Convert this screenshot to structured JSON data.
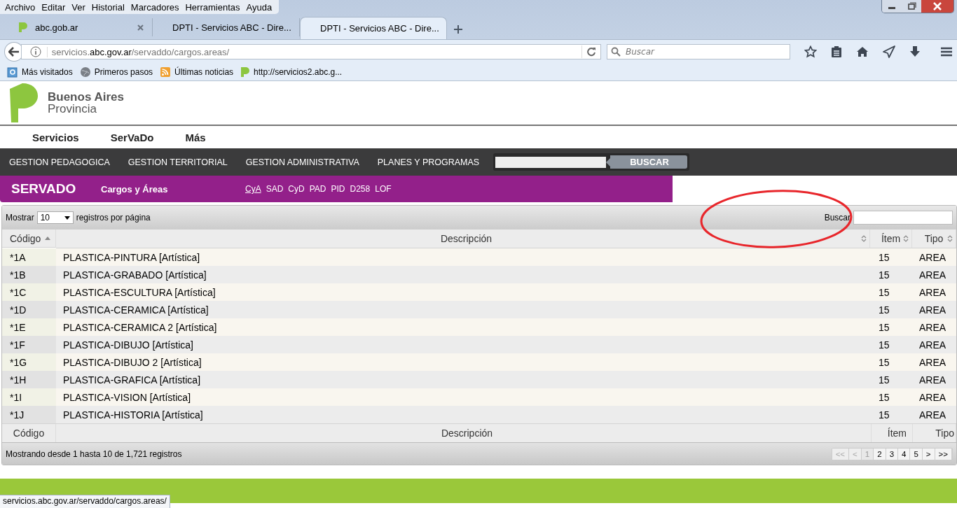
{
  "menu_bar": [
    "Archivo",
    "Editar",
    "Ver",
    "Historial",
    "Marcadores",
    "Herramientas",
    "Ayuda"
  ],
  "tabs": [
    {
      "label": "abc.gob.ar",
      "selected": false
    },
    {
      "label": "DPTI - Servicios ABC - Dire...",
      "selected": false
    },
    {
      "label": "DPTI - Servicios ABC - Dire...",
      "selected": true
    }
  ],
  "address_bar": {
    "url": "servicios.**abc.gov.ar**/servaddo/cargos.areas/"
  },
  "search_bar": {
    "placeholder": "Buscar"
  },
  "bookmarks": [
    {
      "label": "Más visitados",
      "kind": "folder"
    },
    {
      "label": "Primeros pasos",
      "kind": "globe"
    },
    {
      "label": "Últimas noticias",
      "kind": "feed"
    },
    {
      "label": "http://servicios2.abc.g...",
      "kind": "site"
    }
  ],
  "site": {
    "logo": {
      "line1": "Buenos Aires",
      "line2": "Provincia"
    },
    "main_nav": [
      "Servicios",
      "SerVaDo",
      "Más"
    ],
    "sections": [
      "GESTION PEDAGOGICA",
      "GESTION TERRITORIAL",
      "GESTION ADMINISTRATIVA",
      "PLANES Y PROGRAMAS"
    ],
    "search_button": "BUSCAR",
    "banner": {
      "title": "SERVADO",
      "subtitle": "Cargos y Áreas",
      "links": [
        {
          "label": "CyA",
          "selected": true
        },
        {
          "label": "SAD",
          "selected": false
        },
        {
          "label": "CyD",
          "selected": false
        },
        {
          "label": "PAD",
          "selected": false
        },
        {
          "label": "PID",
          "selected": false
        },
        {
          "label": "D258",
          "selected": false
        },
        {
          "label": "LOF",
          "selected": false
        }
      ]
    }
  },
  "table": {
    "length_before": "Mostrar",
    "length_value": "10",
    "length_after": "registros por página",
    "filter_label": "Buscar",
    "columns": [
      {
        "label": "Código",
        "sorted_ascending": true
      },
      {
        "label": "Descripción",
        "sorted_ascending": false
      },
      {
        "label": "Ítem",
        "sorted_ascending": false
      },
      {
        "label": "Tipo",
        "sorted_ascending": false
      }
    ],
    "rows": [
      {
        "code": "*1A",
        "description": "PLASTICA-PINTURA [Artística]",
        "item": "15",
        "type": "AREA"
      },
      {
        "code": "*1B",
        "description": "PLASTICA-GRABADO [Artística]",
        "item": "15",
        "type": "AREA"
      },
      {
        "code": "*1C",
        "description": "PLASTICA-ESCULTURA [Artística]",
        "item": "15",
        "type": "AREA"
      },
      {
        "code": "*1D",
        "description": "PLASTICA-CERAMICA [Artística]",
        "item": "15",
        "type": "AREA"
      },
      {
        "code": "*1E",
        "description": "PLASTICA-CERAMICA 2 [Artística]",
        "item": "15",
        "type": "AREA"
      },
      {
        "code": "*1F",
        "description": "PLASTICA-DIBUJO [Artística]",
        "item": "15",
        "type": "AREA"
      },
      {
        "code": "*1G",
        "description": "PLASTICA-DIBUJO 2 [Artística]",
        "item": "15",
        "type": "AREA"
      },
      {
        "code": "*1H",
        "description": "PLASTICA-GRAFICA [Artística]",
        "item": "15",
        "type": "AREA"
      },
      {
        "code": "*1I",
        "description": "PLASTICA-VISION [Artística]",
        "item": "15",
        "type": "AREA"
      },
      {
        "code": "*1J",
        "description": "PLASTICA-HISTORIA [Artística]",
        "item": "15",
        "type": "AREA"
      }
    ],
    "footer_columns": [
      "Código",
      "Descripción",
      "Ítem",
      "Tipo"
    ],
    "info": "Mostrando desde 1 hasta 10 de 1,721 registros",
    "pagination": [
      {
        "label": "<<",
        "kind": "disabled"
      },
      {
        "label": "<",
        "kind": "disabled"
      },
      {
        "label": "1",
        "kind": "current"
      },
      {
        "label": "2",
        "kind": "page"
      },
      {
        "label": "3",
        "kind": "page"
      },
      {
        "label": "4",
        "kind": "page"
      },
      {
        "label": "5",
        "kind": "page"
      },
      {
        "label": ">",
        "kind": "page"
      },
      {
        "label": ">>",
        "kind": "page"
      }
    ]
  },
  "status_tip": "servicios.abc.gov.ar/servaddo/cargos.areas/"
}
